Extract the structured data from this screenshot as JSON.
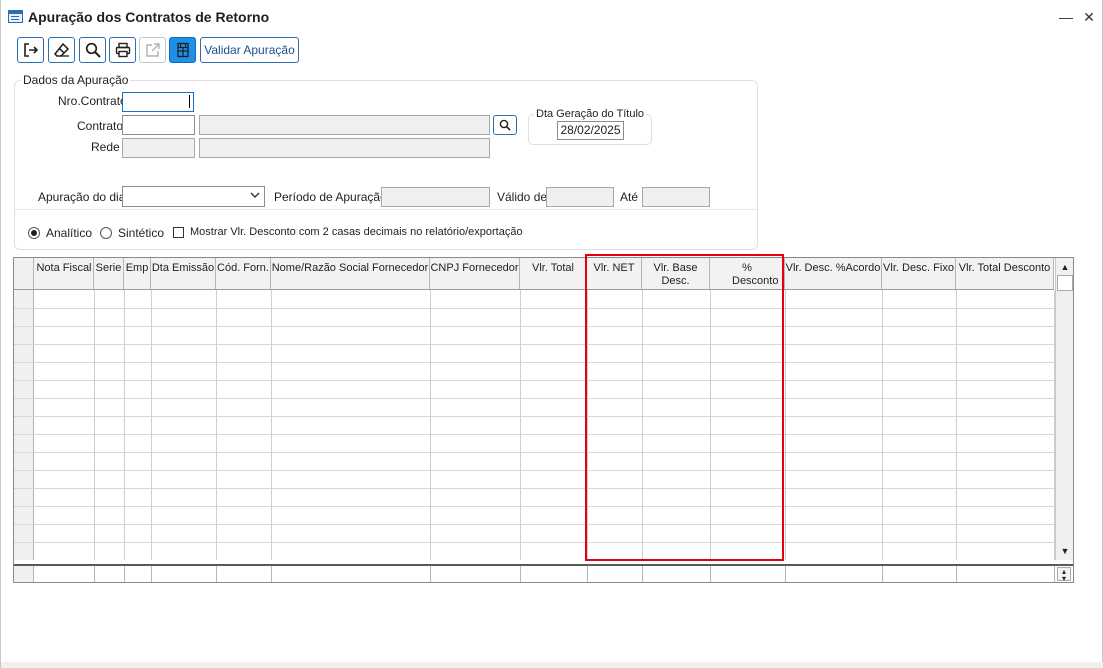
{
  "window": {
    "title": "Apuração dos Contratos de Retorno",
    "minimize_glyph": "—",
    "close_glyph": "✕"
  },
  "toolbar": {
    "buttons": [
      {
        "name": "exit-icon"
      },
      {
        "name": "eraser-icon"
      },
      {
        "name": "search-icon"
      },
      {
        "name": "print-icon"
      },
      {
        "name": "export-icon",
        "disabled": true
      },
      {
        "name": "grid-toggle-icon",
        "active": true
      }
    ],
    "validate_label": "Validar Apuração"
  },
  "form": {
    "group_title": "Dados da Apuração",
    "nro_contrato_label": "Nro.Contrato",
    "nro_contrato_value": "",
    "contrato_label": "Contrato",
    "contrato_code": "",
    "contrato_desc": "",
    "rede_label": "Rede",
    "rede_code": "",
    "rede_desc": "",
    "dta_geracao_label": "Dta Geração do Título",
    "dta_geracao_value": "28/02/2025",
    "apuracao_dia_label": "Apuração do dia",
    "apuracao_dia_value": "",
    "periodo_label": "Período de Apuração",
    "periodo_value": "",
    "valido_de_label": "Válido de",
    "valido_de_value": "",
    "ate_label": "Até",
    "ate_value": "",
    "radio_analitico": "Analítico",
    "radio_sintetico": "Sintético",
    "selected_mode": "Analítico",
    "checkbox_label": "Mostrar Vlr. Desconto com 2 casas decimais no relatório/exportação",
    "checkbox_checked": false
  },
  "grid": {
    "columns": [
      "Nota Fiscal",
      "Serie",
      "Emp",
      "Dta Emissão",
      "Cód. Forn.",
      "Nome/Razão Social Fornecedor",
      "CNPJ Fornecedor",
      "Vlr. Total",
      "Vlr. NET",
      "Vlr. Base Desc.",
      "% Desconto",
      "Vlr. Desc. %Acordo",
      "Vlr. Desc. Fixo",
      "Vlr. Total Desconto"
    ],
    "rows": []
  },
  "colors": {
    "accent": "#2c6fb4",
    "active_button": "#1e90e8",
    "highlight": "#e3000f"
  }
}
